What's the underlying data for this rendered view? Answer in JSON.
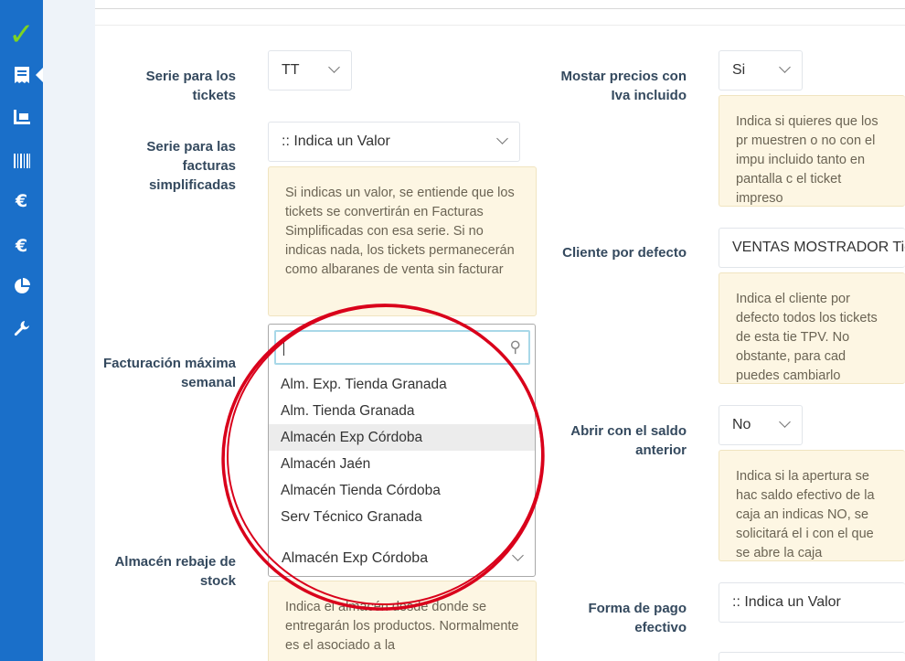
{
  "sidebar": {
    "items": [
      {
        "icon": "check-logo-icon"
      },
      {
        "icon": "receipt-icon"
      },
      {
        "icon": "cart-icon"
      },
      {
        "icon": "barcode-icon"
      },
      {
        "icon": "euro-icon"
      },
      {
        "icon": "euro-icon"
      },
      {
        "icon": "pie-chart-icon"
      },
      {
        "icon": "wrench-icon"
      }
    ],
    "colors": {
      "background": "#1a6fc9",
      "logo": "#7ed321"
    }
  },
  "left": {
    "serie_tickets": {
      "label": "Serie para los tickets",
      "value": "TT"
    },
    "serie_facturas": {
      "label": "Serie para las facturas simplificadas",
      "value": ":: Indica un Valor",
      "note": "Si indicas un valor, se entiende que los tickets se convertirán en Facturas Simplificadas con esa serie. Si no indicas nada, los tickets permanecerán como albaranes de venta sin facturar"
    },
    "facturacion": {
      "label": "Facturación máxima semanal"
    },
    "almacen": {
      "label": "Almacén rebaje de stock",
      "value": "Almacén Exp Córdoba",
      "note": "Indica el almacén desde donde se entregarán los productos. Normalmente es el asociado a la"
    }
  },
  "dropdown": {
    "search_value": "",
    "options": [
      "Alm. Exp. Tienda Granada",
      "Alm. Tienda Granada",
      "Almacén Exp Córdoba",
      "Almacén Jaén",
      "Almacén Tienda Córdoba",
      "Serv Técnico Granada"
    ],
    "highlighted": "Almacén Exp Córdoba",
    "annotation_color": "#d9001b"
  },
  "right": {
    "precios_iva": {
      "label": "Mostar precios con Iva incluido",
      "value": "Si",
      "note": "Indica si quieres que los pr muestren o no con el impu incluido tanto en pantalla c el ticket impreso"
    },
    "cliente": {
      "label": "Cliente por defecto",
      "value": "VENTAS MOSTRADOR Tie",
      "note": "Indica el cliente por defecto todos los tickets de esta tie TPV. No obstante, para cad puedes cambiarlo"
    },
    "saldo": {
      "label": "Abrir con el saldo anterior",
      "value": "No",
      "note": "Indica si la apertura se hac saldo efectivo de la caja an indicas NO, se solicitará el i con el que se abre la caja"
    },
    "forma_pago": {
      "label": "Forma de pago efectivo",
      "value": ":: Indica un Valor"
    }
  }
}
